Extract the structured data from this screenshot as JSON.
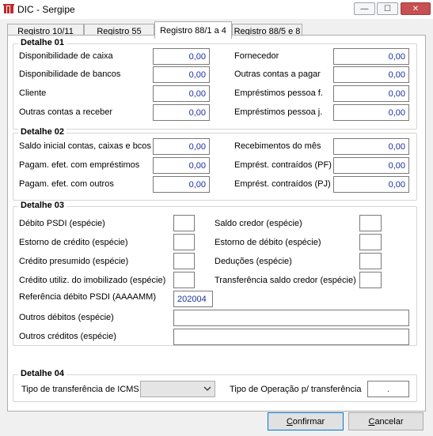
{
  "window": {
    "title": "DIC - Sergipe",
    "min_glyph": "—",
    "max_glyph": "☐",
    "close_glyph": "✕"
  },
  "tabs": [
    "Registro 10/11",
    "Registro 55",
    "Registro 88/1 a 4",
    "Registro 88/5 e 8"
  ],
  "detalhe01": {
    "title": "Detalhe 01",
    "rows": [
      {
        "left_label": "Disponibilidade de caixa",
        "left_value": "0,00",
        "right_label": "Fornecedor",
        "right_value": "0,00"
      },
      {
        "left_label": "Disponibilidade de bancos",
        "left_value": "0,00",
        "right_label": "Outras contas a pagar",
        "right_value": "0,00"
      },
      {
        "left_label": "Cliente",
        "left_value": "0,00",
        "right_label": "Empréstimos pessoa f.",
        "right_value": "0,00"
      },
      {
        "left_label": "Outras contas a receber",
        "left_value": "0,00",
        "right_label": "Empréstimos pessoa j.",
        "right_value": "0,00"
      }
    ]
  },
  "detalhe02": {
    "title": "Detalhe 02",
    "rows": [
      {
        "left_label": "Saldo inicial contas, caixas e bcos",
        "left_value": "0,00",
        "right_label": "Recebimentos do mês",
        "right_value": "0,00"
      },
      {
        "left_label": "Pagam. efet. com empréstimos",
        "left_value": "0,00",
        "right_label": "Emprést. contraídos (PF)",
        "right_value": "0,00"
      },
      {
        "left_label": "Pagam. efet. com outros",
        "left_value": "0,00",
        "right_label": "Emprést. contraídos (PJ)",
        "right_value": "0,00"
      }
    ]
  },
  "detalhe03": {
    "title": "Detalhe 03",
    "rows": [
      {
        "left_label": "Débito PSDI (espécie)",
        "left_value": "",
        "right_label": "Saldo credor (espécie)",
        "right_value": ""
      },
      {
        "left_label": "Estorno de crédito (espécie)",
        "left_value": "",
        "right_label": "Estorno de débito (espécie)",
        "right_value": ""
      },
      {
        "left_label": "Crédito presumido (espécie)",
        "left_value": "",
        "right_label": "Deduções (espécie)",
        "right_value": ""
      },
      {
        "left_label": "Crédito utiliz. do imobilizado (espécie)",
        "left_value": "",
        "right_label": "Transferência saldo credor (espécie)",
        "right_value": ""
      }
    ],
    "referencia_label": "Referência débito PSDI (AAAAMM)",
    "referencia_value": "202004",
    "outros_debitos_label": "Outros débitos (espécie)",
    "outros_debitos_value": "",
    "outros_creditos_label": "Outros créditos (espécie)",
    "outros_creditos_value": ""
  },
  "detalhe04": {
    "title": "Detalhe 04",
    "tipo_transferencia_label": "Tipo de transferência de ICMS",
    "tipo_transferencia_value": "",
    "tipo_operacao_label": "Tipo de Operação p/ transferência",
    "tipo_operacao_value": "."
  },
  "buttons": {
    "confirmar_underlined": "C",
    "confirmar_rest": "onfirmar",
    "cancelar_underlined": "C",
    "cancelar_rest": "ancelar"
  },
  "colors": {
    "value_text": "#1a2fa0",
    "icon_red": "#c0282d",
    "accent": "#0078d7"
  }
}
